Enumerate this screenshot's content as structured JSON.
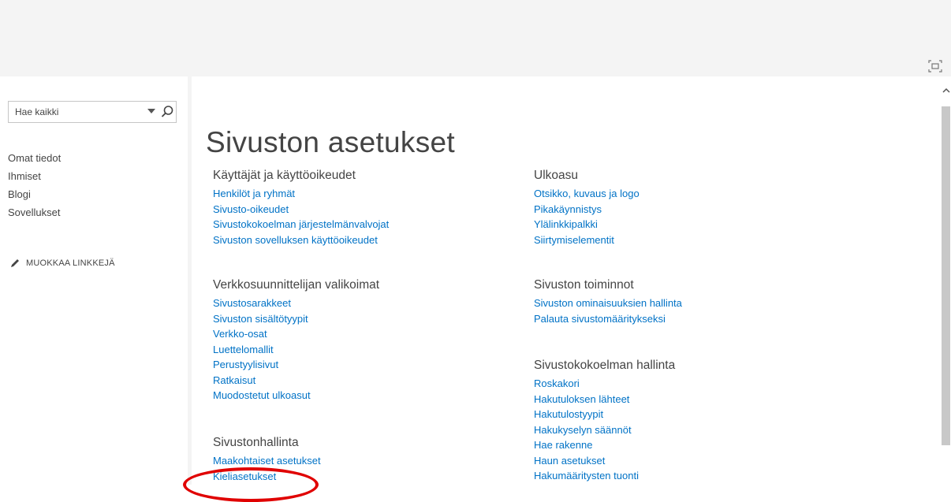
{
  "search": {
    "placeholder": "Hae kaikki"
  },
  "nav": {
    "items": [
      {
        "label": "Omat tiedot"
      },
      {
        "label": "Ihmiset"
      },
      {
        "label": "Blogi"
      },
      {
        "label": "Sovellukset"
      }
    ],
    "edit_links_label": "MUOKKAA LINKKEJÄ"
  },
  "page": {
    "title": "Sivuston asetukset"
  },
  "sections": {
    "users": {
      "heading": "Käyttäjät ja käyttöoikeudet",
      "links": [
        "Henkilöt ja ryhmät",
        "Sivusto-oikeudet",
        "Sivustokokoelman järjestelmänvalvojat",
        "Sivuston sovelluksen käyttöoikeudet"
      ]
    },
    "gallery": {
      "heading": "Verkkosuunnittelijan valikoimat",
      "links": [
        "Sivustosarakkeet",
        "Sivuston sisältötyypit",
        "Verkko-osat",
        "Luettelomallit",
        "Perustyylisivut",
        "Ratkaisut",
        "Muodostetut ulkoasut"
      ]
    },
    "admin": {
      "heading": "Sivustonhallinta",
      "links": [
        "Maakohtaiset asetukset",
        "Kieliasetukset"
      ]
    },
    "look": {
      "heading": "Ulkoasu",
      "links": [
        "Otsikko, kuvaus ja logo",
        "Pikakäynnistys",
        "Ylälinkkipalkki",
        "Siirtymiselementit"
      ]
    },
    "actions": {
      "heading": "Sivuston toiminnot",
      "links": [
        "Sivuston ominaisuuksien hallinta",
        "Palauta sivustomääritykseksi"
      ]
    },
    "collection": {
      "heading": "Sivustokokoelman hallinta",
      "links": [
        "Roskakori",
        "Hakutuloksen lähteet",
        "Hakutulostyypit",
        "Hakukyselyn säännöt",
        "Hae rakenne",
        "Haun asetukset",
        "Hakumääritysten tuonti"
      ]
    }
  },
  "icons": {
    "focus": "focus-mode-icon",
    "search": "search-icon",
    "dropdown": "chevron-down-icon",
    "edit": "pencil-icon"
  },
  "colors": {
    "link": "#0072c6",
    "text": "#444444",
    "annotation": "#e00000"
  }
}
